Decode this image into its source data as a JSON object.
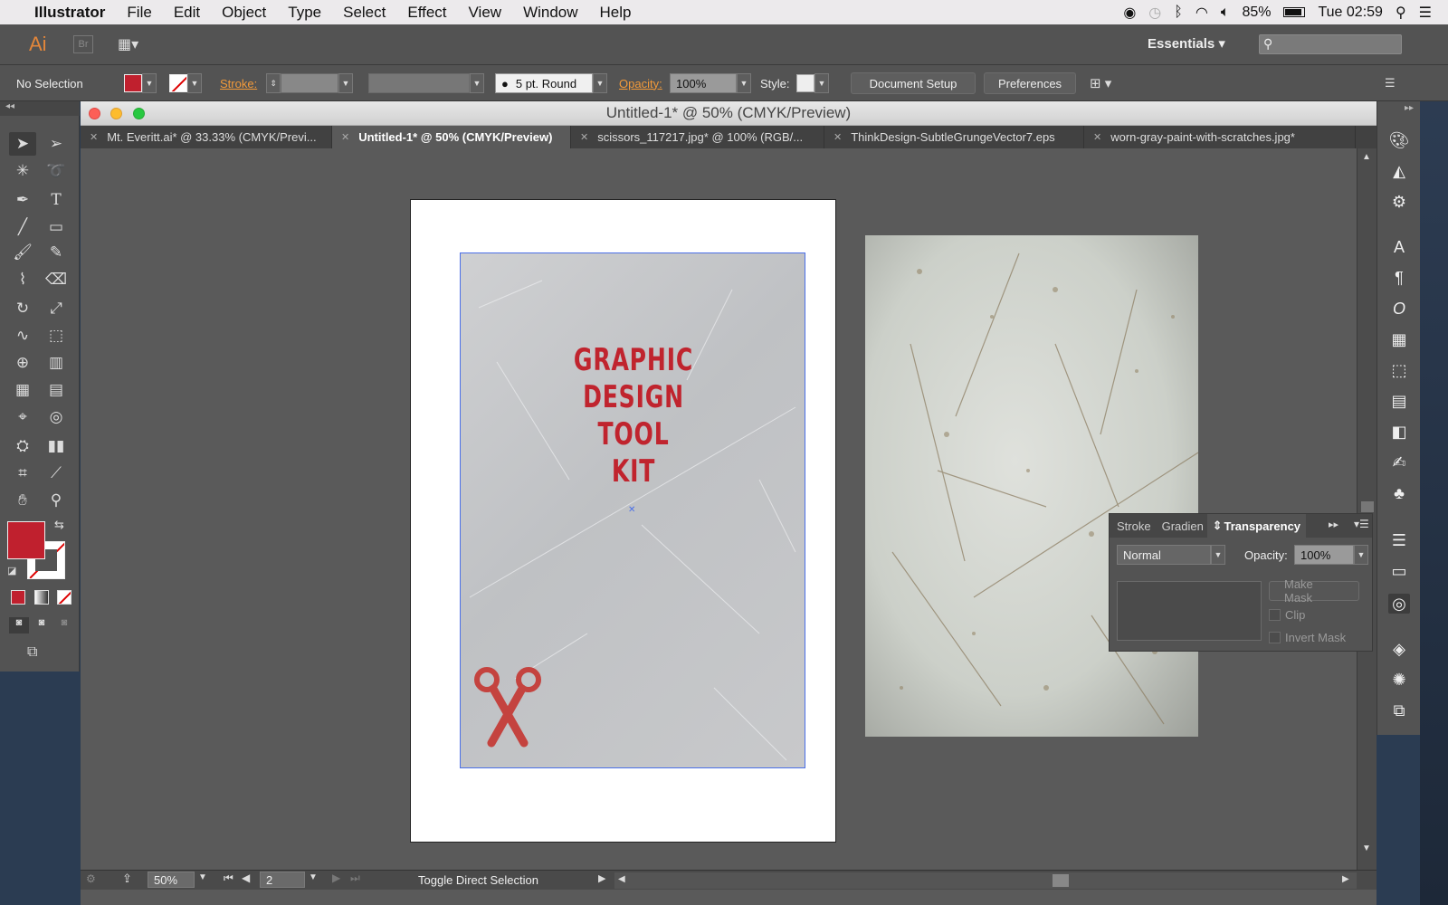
{
  "menubar": {
    "app": "Illustrator",
    "items": [
      "File",
      "Edit",
      "Object",
      "Type",
      "Select",
      "Effect",
      "View",
      "Window",
      "Help"
    ],
    "battery": "85%",
    "clock": "Tue 02:59"
  },
  "appbar": {
    "logo": "Ai",
    "bridge": "Br",
    "workspace": "Essentials"
  },
  "control": {
    "selection": "No Selection",
    "stroke_label": "Stroke:",
    "brush": "5 pt. Round",
    "opacity_label": "Opacity:",
    "opacity_value": "100%",
    "style_label": "Style:",
    "doc_setup": "Document Setup",
    "preferences": "Preferences",
    "fill_color": "#c0202e"
  },
  "window": {
    "title": "Untitled-1* @ 50% (CMYK/Preview)",
    "tabs": [
      "Mt. Everitt.ai* @ 33.33% (CMYK/Previ...",
      "Untitled-1* @ 50% (CMYK/Preview)",
      "scissors_117217.jpg* @ 100% (RGB/...",
      "ThinkDesign-SubtleGrungeVector7.eps",
      "worn-gray-paint-with-scratches.jpg*"
    ]
  },
  "poster": {
    "line1": "GRAPHIC",
    "line2": "DESIGN",
    "line3": "TOOL",
    "line4": "KIT",
    "accent": "#c0242e"
  },
  "status": {
    "zoom": "50%",
    "artboard": "2",
    "message": "Toggle Direct Selection"
  },
  "transparency_panel": {
    "tabs": [
      "Stroke",
      "Gradien",
      "Transparency"
    ],
    "blend_mode": "Normal",
    "opacity_label": "Opacity:",
    "opacity_value": "100%",
    "make_mask": "Make Mask",
    "clip": "Clip",
    "invert_mask": "Invert Mask"
  }
}
